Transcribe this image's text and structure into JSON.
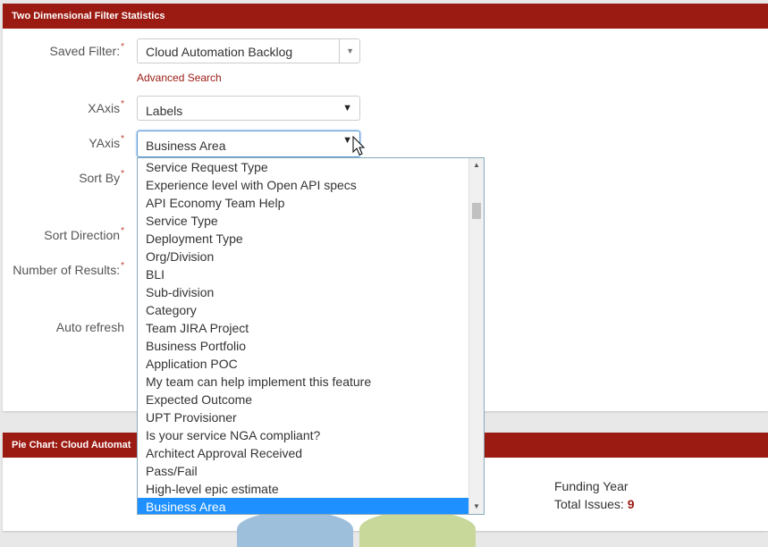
{
  "panel1": {
    "title": "Two Dimensional Filter Statistics",
    "saved_filter_label": "Saved Filter:",
    "saved_filter_value": "Cloud Automation Backlog",
    "advanced_search": "Advanced Search",
    "xaxis_label": "XAxis",
    "xaxis_value": "Labels",
    "yaxis_label": "YAxis",
    "yaxis_value": "Business Area",
    "sort_by_label": "Sort By",
    "sort_direction_label": "Sort Direction",
    "num_results_label": "Number of Results:",
    "auto_refresh_label": "Auto refresh",
    "required_mark": "*"
  },
  "dropdown": {
    "options": [
      "Service Request Type",
      "Experience level with Open API specs",
      "API Economy Team Help",
      "Service Type",
      "Deployment Type",
      "Org/Division",
      "BLI",
      "Sub-division",
      "Category",
      "Team JIRA Project",
      "Business Portfolio",
      "Application POC",
      "My team can help implement this feature",
      "Expected Outcome",
      "UPT Provisioner",
      "Is your service NGA compliant?",
      "Architect Approval Received",
      "Pass/Fail",
      "High-level epic estimate",
      "Business Area"
    ],
    "selected": "Business Area"
  },
  "panel2": {
    "title": "Pie Chart: Cloud Automat",
    "funding_year": "Funding Year",
    "total_issues_label": "Total Issues:",
    "total_issues_value": "9"
  },
  "colors": {
    "header": "#9b1a12",
    "selected_option": "#1e90ff",
    "pie_blue": "#9ebfdc",
    "pie_green": "#c8d89a"
  }
}
